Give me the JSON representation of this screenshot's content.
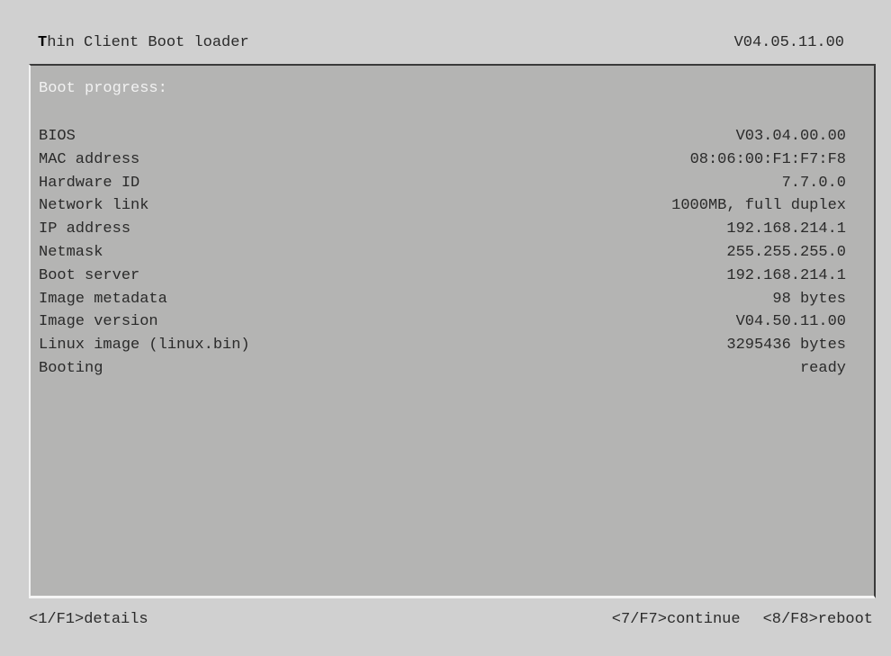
{
  "header": {
    "title_first": "T",
    "title_rest": "hin Client Boot loader",
    "version": "V04.05.11.00"
  },
  "panel": {
    "heading": "Boot progress:",
    "rows": [
      {
        "label": "BIOS",
        "value": "V03.04.00.00"
      },
      {
        "label": "MAC address",
        "value": "08:06:00:F1:F7:F8"
      },
      {
        "label": "Hardware ID",
        "value": "7.7.0.0"
      },
      {
        "label": "Network link",
        "value": "1000MB, full duplex"
      },
      {
        "label": "IP address",
        "value": "192.168.214.1"
      },
      {
        "label": "Netmask",
        "value": "255.255.255.0"
      },
      {
        "label": "Boot server",
        "value": "192.168.214.1"
      },
      {
        "label": "Image metadata",
        "value": "98 bytes"
      },
      {
        "label": "Image version",
        "value": "V04.50.11.00"
      },
      {
        "label": "Linux image (linux.bin)",
        "value": "3295436 bytes"
      },
      {
        "label": "Booting",
        "value": "ready"
      }
    ]
  },
  "footer": {
    "details": "<1/F1>details",
    "continue": "<7/F7>continue",
    "reboot": "<8/F8>reboot"
  },
  "colors": {
    "background": "#d0d0d0",
    "panel": "#b4b4b3",
    "heading_text": "#f2f2f2",
    "text": "#2a2a2a"
  }
}
